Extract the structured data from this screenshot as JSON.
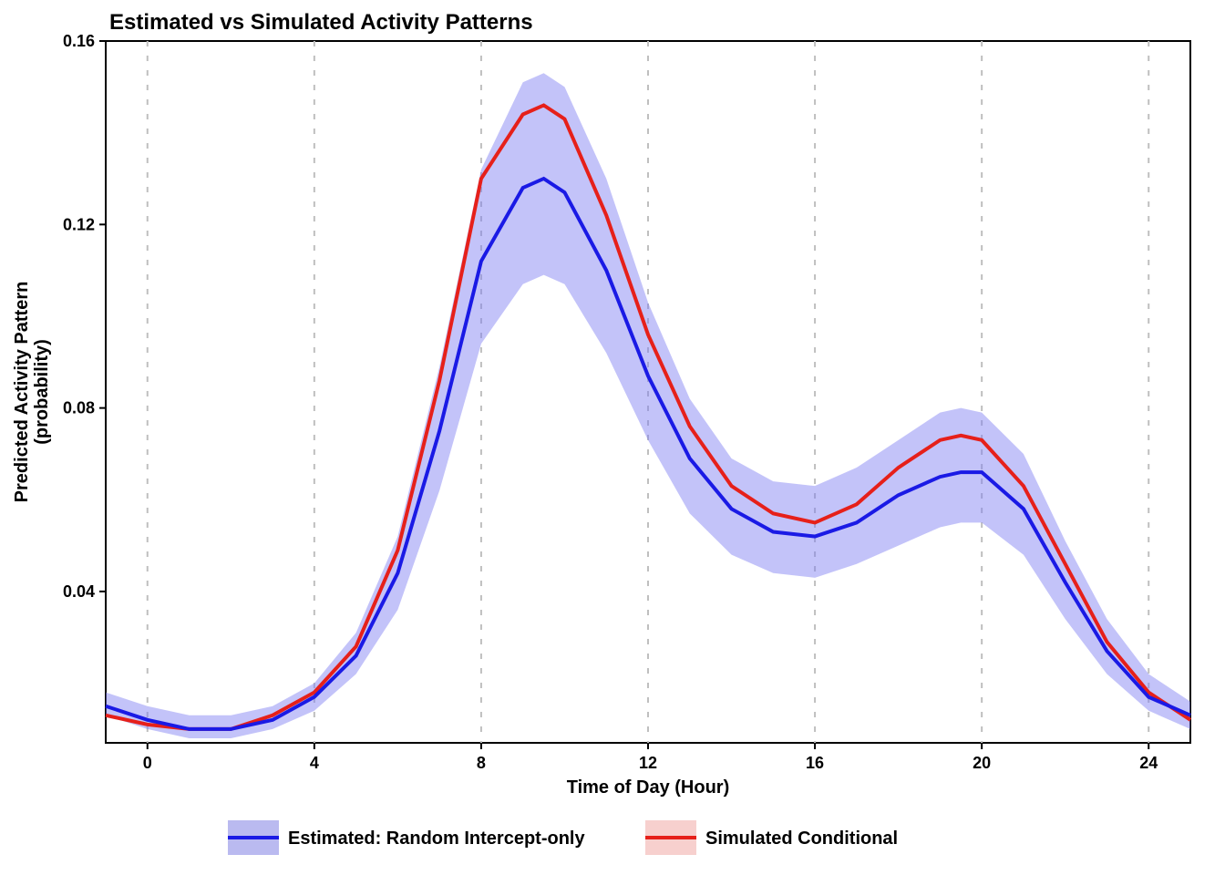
{
  "chart_data": {
    "type": "line",
    "title": "Estimated vs Simulated Activity Patterns",
    "xlabel": "Time of Day (Hour)",
    "ylabel": "Predicted Activity Pattern\n(probability)",
    "xlim": [
      -1,
      25
    ],
    "ylim": [
      0.007,
      0.16
    ],
    "x_ticks": [
      0,
      4,
      8,
      12,
      16,
      20,
      24
    ],
    "y_ticks": [
      0.04,
      0.08,
      0.12,
      0.16
    ],
    "grid": {
      "x": true,
      "y": false
    },
    "x": [
      -1,
      0,
      1,
      2,
      3,
      4,
      5,
      6,
      7,
      8,
      9,
      9.5,
      10,
      11,
      12,
      13,
      14,
      15,
      16,
      17,
      18,
      19,
      19.5,
      20,
      21,
      22,
      23,
      24,
      25
    ],
    "series": [
      {
        "name": "Estimated: Random Intercept-only",
        "color": "#1a1ae5",
        "fill": "#7a7af2",
        "values": [
          0.015,
          0.012,
          0.01,
          0.01,
          0.012,
          0.017,
          0.026,
          0.044,
          0.075,
          0.112,
          0.128,
          0.13,
          0.127,
          0.11,
          0.087,
          0.069,
          0.058,
          0.053,
          0.052,
          0.055,
          0.061,
          0.065,
          0.066,
          0.066,
          0.058,
          0.042,
          0.027,
          0.017,
          0.013
        ],
        "ci_lower": [
          0.013,
          0.01,
          0.008,
          0.008,
          0.01,
          0.014,
          0.022,
          0.036,
          0.062,
          0.094,
          0.107,
          0.109,
          0.107,
          0.092,
          0.073,
          0.057,
          0.048,
          0.044,
          0.043,
          0.046,
          0.05,
          0.054,
          0.055,
          0.055,
          0.048,
          0.034,
          0.022,
          0.014,
          0.01
        ],
        "ci_upper": [
          0.018,
          0.015,
          0.013,
          0.013,
          0.015,
          0.02,
          0.031,
          0.052,
          0.089,
          0.132,
          0.151,
          0.153,
          0.15,
          0.13,
          0.103,
          0.082,
          0.069,
          0.064,
          0.063,
          0.067,
          0.073,
          0.079,
          0.08,
          0.079,
          0.07,
          0.051,
          0.034,
          0.022,
          0.016
        ]
      },
      {
        "name": "Simulated Conditional",
        "color": "#e6201a",
        "fill": "#f29d9a",
        "values": [
          0.013,
          0.011,
          0.01,
          0.01,
          0.013,
          0.018,
          0.028,
          0.049,
          0.086,
          0.13,
          0.144,
          0.146,
          0.143,
          0.122,
          0.096,
          0.076,
          0.063,
          0.057,
          0.055,
          0.059,
          0.067,
          0.073,
          0.074,
          0.073,
          0.063,
          0.046,
          0.029,
          0.018,
          0.012
        ]
      }
    ],
    "legend": {
      "position": "bottom",
      "items": [
        {
          "label": "Estimated: Random Intercept-only",
          "color": "#1a1ae5",
          "fill": "#babaf0"
        },
        {
          "label": "Simulated Conditional",
          "color": "#e6201a",
          "fill": "#f7d0ce"
        }
      ]
    }
  }
}
